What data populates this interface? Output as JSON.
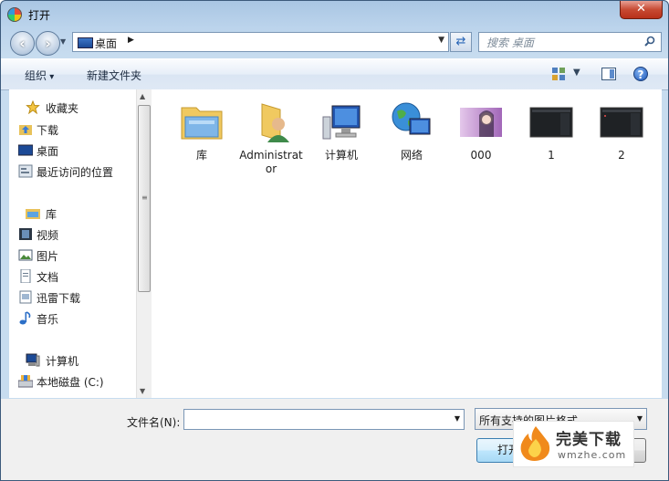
{
  "window": {
    "title": "打开",
    "close_label": "✕"
  },
  "nav": {
    "address": "桌面",
    "search_placeholder": "搜索 桌面"
  },
  "toolbar": {
    "organize_label": "组织",
    "new_folder_label": "新建文件夹",
    "help_label": "?"
  },
  "sidebar": {
    "favorites": {
      "label": "收藏夹",
      "items": [
        "下载",
        "桌面",
        "最近访问的位置"
      ]
    },
    "libraries": {
      "label": "库",
      "items": [
        "视频",
        "图片",
        "文档",
        "迅雷下载",
        "音乐"
      ]
    },
    "computer": {
      "label": "计算机",
      "items": [
        "本地磁盘 (C:)"
      ]
    }
  },
  "files": [
    {
      "name": "库",
      "icon": "library-folder-icon"
    },
    {
      "name": "Administrator",
      "icon": "user-folder-icon"
    },
    {
      "name": "计算机",
      "icon": "computer-icon"
    },
    {
      "name": "网络",
      "icon": "network-globe-icon"
    },
    {
      "name": "000",
      "icon": "image-thumbnail"
    },
    {
      "name": "1",
      "icon": "image-thumbnail-dark"
    },
    {
      "name": "2",
      "icon": "image-thumbnail-dark"
    }
  ],
  "bottom": {
    "filename_label": "文件名(N):",
    "filename_value": "",
    "filter_value": "所有支持的图片格式",
    "open_label": "打开",
    "cancel_label": ""
  },
  "watermark": {
    "brand": "完美下载",
    "url": "wmzhe.com"
  },
  "colors": {
    "accent": "#3c7fb1",
    "close": "#c74a33",
    "frame": "#c7dcef"
  }
}
